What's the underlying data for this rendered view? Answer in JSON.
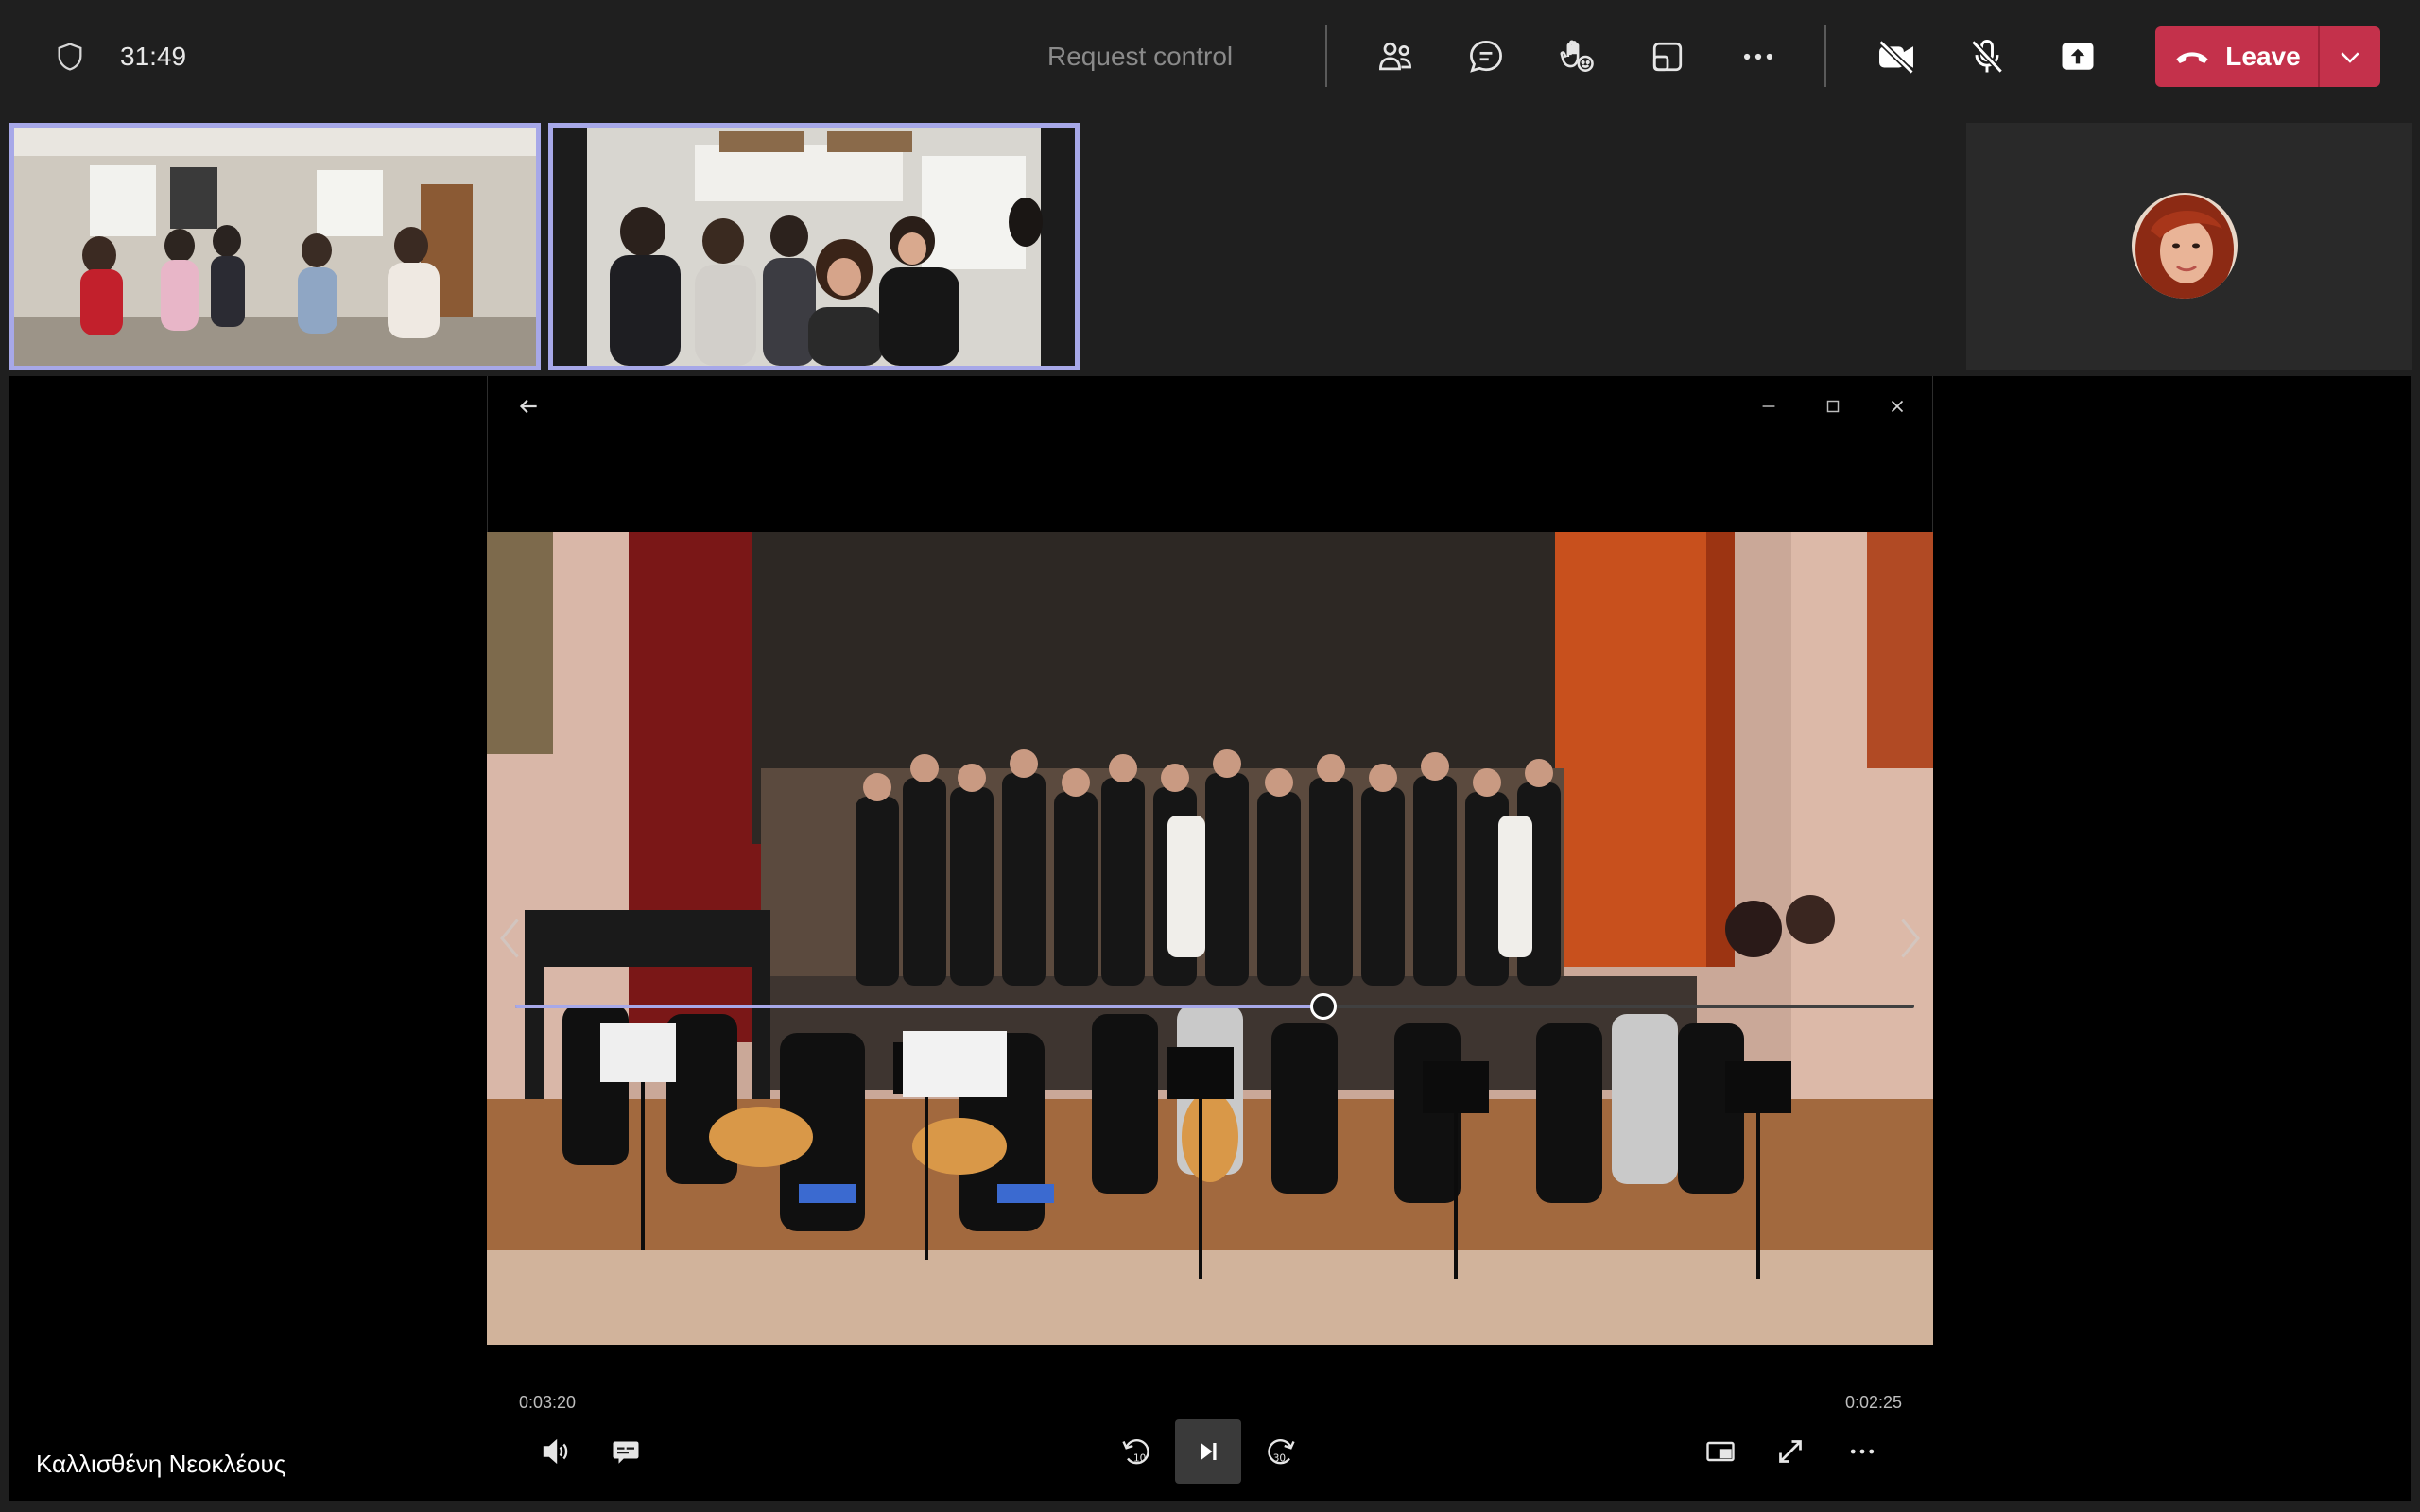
{
  "meeting": {
    "timer": "31:49",
    "request_control_label": "Request control",
    "leave_label": "Leave"
  },
  "toolbar": {
    "icons": [
      "people-icon",
      "chat-icon",
      "raise-hand-icon",
      "share-tray-icon",
      "more-options-icon",
      "camera-off-icon",
      "mic-off-icon",
      "share-content-icon"
    ]
  },
  "player": {
    "current_time": "0:03:20",
    "duration": "0:02:25",
    "progress_percent": 57.8
  },
  "participant_name": "Καλλισθένη Νεοκλέους",
  "colors": {
    "accent": "#a7a8e8",
    "leave": "#c4314b",
    "topbar": "#1f1f1f"
  }
}
